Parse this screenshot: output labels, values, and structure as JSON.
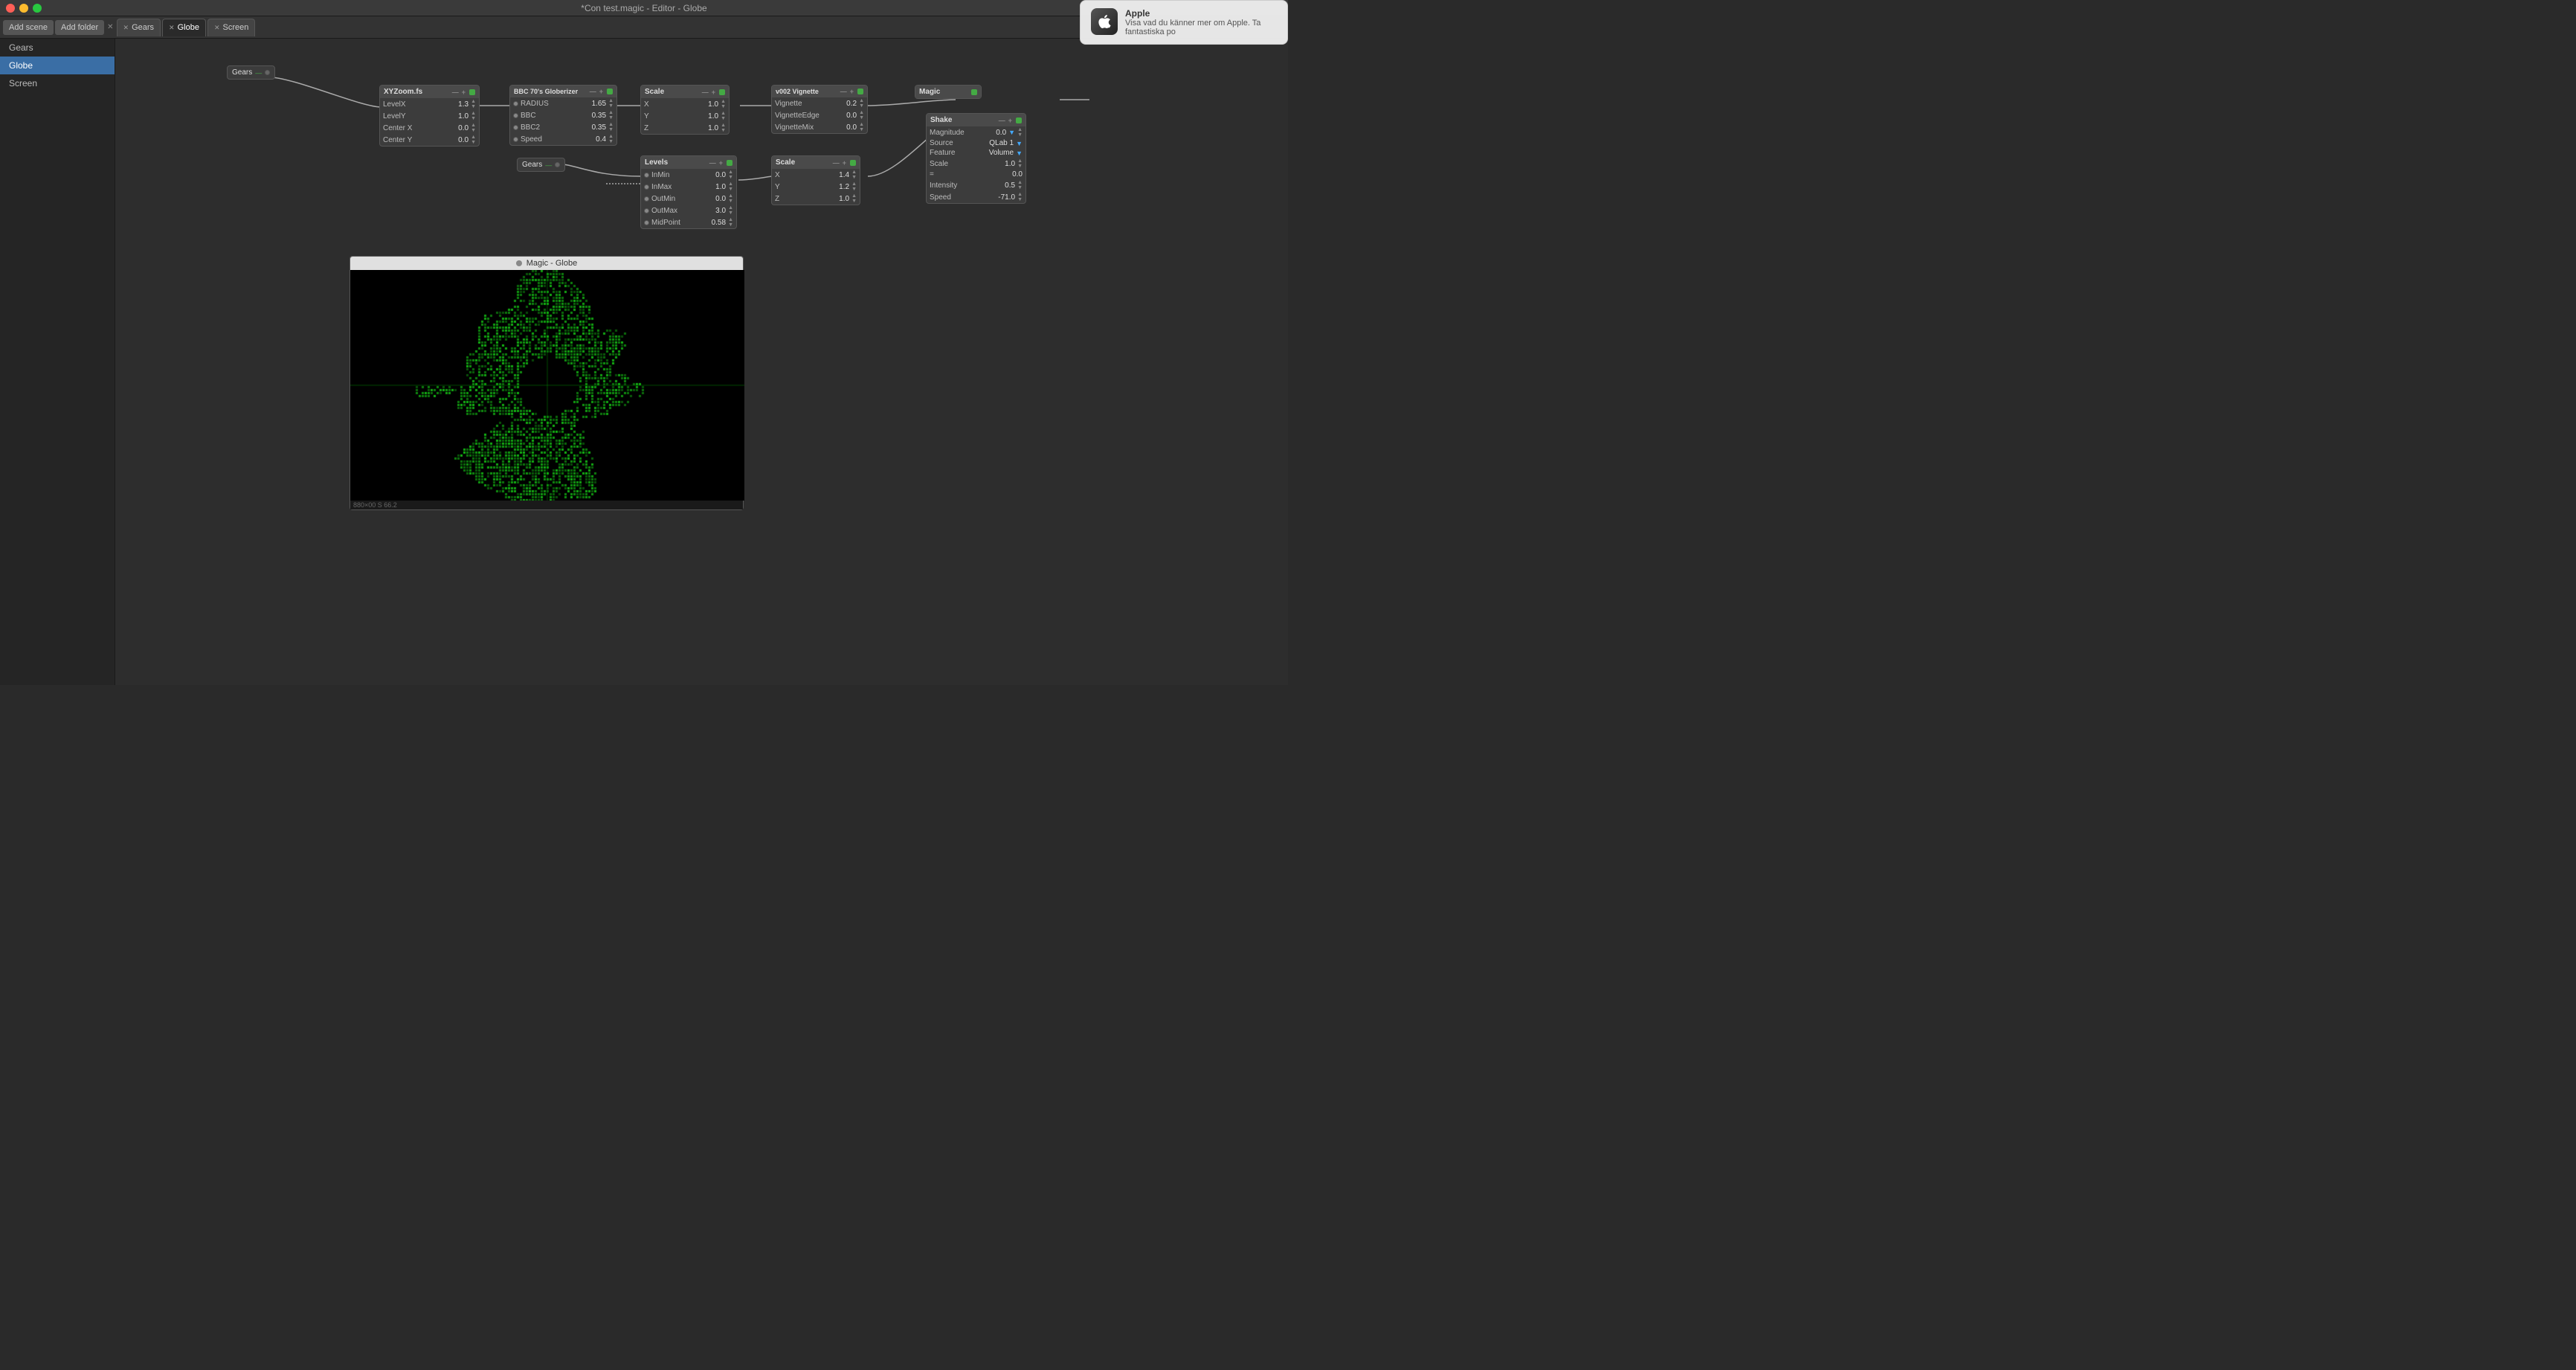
{
  "titleBar": {
    "title": "*Con test.magic - Editor - Globe"
  },
  "tabs": {
    "addScene": "Add scene",
    "addFolder": "Add folder",
    "items": [
      {
        "label": "Gears",
        "active": false
      },
      {
        "label": "Globe",
        "active": true
      },
      {
        "label": "Screen",
        "active": false
      }
    ]
  },
  "sidebar": {
    "items": [
      {
        "label": "Gears",
        "active": false
      },
      {
        "label": "Globe",
        "active": true
      },
      {
        "label": "Screen",
        "active": false
      }
    ]
  },
  "nodes": {
    "gearsSource": {
      "label": "Gears"
    },
    "gearsSource2": {
      "label": "Gears"
    },
    "xyzoom": {
      "title": "XYZoom.fs",
      "params": [
        {
          "label": "LevelX",
          "value": "1.3"
        },
        {
          "label": "LevelY",
          "value": "1.0"
        },
        {
          "label": "Center X",
          "value": "0.0"
        },
        {
          "label": "Center Y",
          "value": "0.0"
        }
      ]
    },
    "bbc70": {
      "title": "BBC 70's Globerizer",
      "params": [
        {
          "label": "RADIUS",
          "value": "1.65"
        },
        {
          "label": "BBC",
          "value": "0.35"
        },
        {
          "label": "BBC2",
          "value": "0.35"
        },
        {
          "label": "Speed",
          "value": "0.4"
        }
      ]
    },
    "scale1": {
      "title": "Scale",
      "params": [
        {
          "label": "X",
          "value": "1.0"
        },
        {
          "label": "Y",
          "value": "1.0"
        },
        {
          "label": "Z",
          "value": "1.0"
        }
      ]
    },
    "vignette": {
      "title": "v002 Vignette",
      "params": [
        {
          "label": "Vignette",
          "value": "0.2"
        },
        {
          "label": "VignetteEdge",
          "value": "0.0"
        },
        {
          "label": "VignetteMix",
          "value": "0.0"
        }
      ]
    },
    "magic": {
      "title": "Magic"
    },
    "levels": {
      "title": "Levels",
      "params": [
        {
          "label": "InMin",
          "value": "0.0"
        },
        {
          "label": "InMax",
          "value": "1.0"
        },
        {
          "label": "OutMin",
          "value": "0.0"
        },
        {
          "label": "OutMax",
          "value": "3.0"
        },
        {
          "label": "MidPoint",
          "value": "0.58"
        }
      ]
    },
    "scale2": {
      "title": "Scale",
      "params": [
        {
          "label": "X",
          "value": "1.4"
        },
        {
          "label": "Y",
          "value": "1.2"
        },
        {
          "label": "Z",
          "value": "1.0"
        }
      ]
    },
    "shake": {
      "title": "Shake",
      "params": [
        {
          "label": "Magnitude",
          "value": "0.0"
        },
        {
          "label": "Source",
          "value": "QLab 1"
        },
        {
          "label": "Feature",
          "value": "Volume"
        },
        {
          "label": "Scale",
          "value": "1.0"
        },
        {
          "label": "= ",
          "value": "0.0"
        },
        {
          "label": "Intensity",
          "value": "0.5"
        },
        {
          "label": "Speed",
          "value": "-71.0"
        }
      ]
    }
  },
  "preview": {
    "title": "Magic - Globe",
    "statusText": "880×00 S 66.2"
  },
  "notification": {
    "title": "Apple",
    "body": "Visa vad du känner mer om Apple. Ta fantastiska po"
  }
}
